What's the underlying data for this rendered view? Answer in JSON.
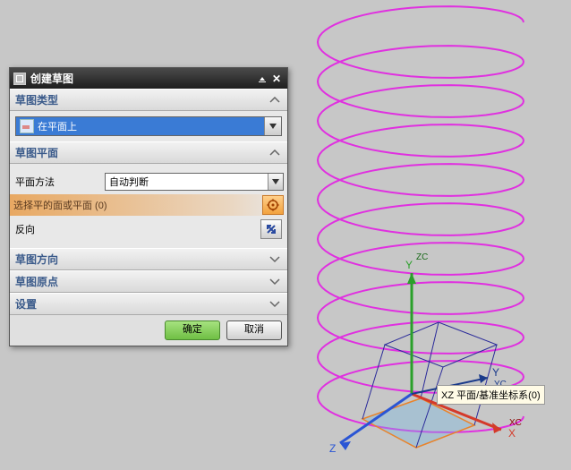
{
  "dialog": {
    "title": "创建草图",
    "sections": {
      "type": {
        "label": "草图类型",
        "value": "在平面上"
      },
      "plane": {
        "label": "草图平面",
        "method_label": "平面方法",
        "method_value": "自动判断",
        "pick_label": "选择平的面或平面 (0)",
        "reverse_label": "反向"
      },
      "direction": {
        "label": "草图方向"
      },
      "origin": {
        "label": "草图原点"
      },
      "settings": {
        "label": "设置"
      }
    },
    "buttons": {
      "ok": "确定",
      "cancel": "取消"
    }
  },
  "viewport": {
    "tooltip": "XZ 平面/基准坐标系(0)",
    "axes": {
      "x": "X",
      "y": "Y",
      "z": "Z",
      "xc": "XC",
      "yc": "YC",
      "zc": "ZC"
    }
  },
  "colors": {
    "accent": "#e8832b",
    "axis_x": "#d43a2a",
    "axis_y": "#2aa02a",
    "axis_z": "#2a55d4",
    "helix": "#e030e0"
  }
}
